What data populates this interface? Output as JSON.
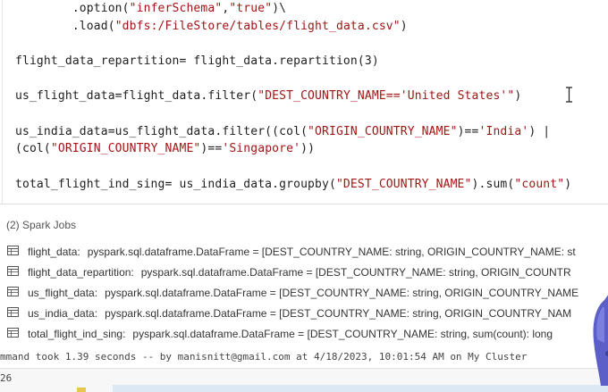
{
  "code": {
    "lines": [
      [
        {
          "t": "        .option("
        },
        {
          "t": "\"inferSchema\"",
          "s": true
        },
        {
          "t": ","
        },
        {
          "t": "\"true\"",
          "s": true
        },
        {
          "t": ")\\"
        }
      ],
      [
        {
          "t": "        .load("
        },
        {
          "t": "\"dbfs:/FileStore/tables/flight_data.csv\"",
          "s": true
        },
        {
          "t": ")"
        }
      ],
      [
        {
          "t": ""
        }
      ],
      [
        {
          "t": "flight_data_repartition= flight_data.repartition(3)"
        }
      ],
      [
        {
          "t": ""
        }
      ],
      [
        {
          "t": "us_flight_data=flight_data.filter("
        },
        {
          "t": "\"DEST_COUNTRY_NAME=='United States'\"",
          "s": true
        },
        {
          "t": ")"
        }
      ],
      [
        {
          "t": ""
        }
      ],
      [
        {
          "t": "us_india_data=us_flight_data.filter((col("
        },
        {
          "t": "\"ORIGIN_COUNTRY_NAME\"",
          "s": true
        },
        {
          "t": ")=="
        },
        {
          "t": "'India'",
          "s": true
        },
        {
          "t": ") |"
        }
      ],
      [
        {
          "t": "(col("
        },
        {
          "t": "\"ORIGIN_COUNTRY_NAME\"",
          "s": true
        },
        {
          "t": ")=="
        },
        {
          "t": "'Singapore'",
          "s": true
        },
        {
          "t": "))"
        }
      ],
      [
        {
          "t": ""
        }
      ],
      [
        {
          "t": "total_flight_ind_sing= us_india_data.groupby("
        },
        {
          "t": "\"DEST_COUNTRY_NAME\"",
          "s": true
        },
        {
          "t": ").sum("
        },
        {
          "t": "\"count\"",
          "s": true
        },
        {
          "t": ")"
        }
      ]
    ]
  },
  "output": {
    "spark_jobs_label": "(2) Spark Jobs",
    "dataframes": [
      {
        "name": "flight_data:",
        "type": "pyspark.sql.dataframe.DataFrame",
        "schema": " = [DEST_COUNTRY_NAME: string, ORIGIN_COUNTRY_NAME: st"
      },
      {
        "name": "flight_data_repartition:",
        "type": "pyspark.sql.dataframe.DataFrame",
        "schema": " = [DEST_COUNTRY_NAME: string, ORIGIN_COUNTR"
      },
      {
        "name": "us_flight_data:",
        "type": "pyspark.sql.dataframe.DataFrame",
        "schema": " = [DEST_COUNTRY_NAME: string, ORIGIN_COUNTRY_NAME"
      },
      {
        "name": "us_india_data:",
        "type": "pyspark.sql.dataframe.DataFrame",
        "schema": " = [DEST_COUNTRY_NAME: string, ORIGIN_COUNTRY_NAM"
      },
      {
        "name": "total_flight_ind_sing:",
        "type": "pyspark.sql.dataframe.DataFrame",
        "schema": " = [DEST_COUNTRY_NAME: string, sum(count): long"
      }
    ],
    "status_line": "mmand took 1.39 seconds -- by manisnitt@gmail.com at 4/18/2023, 10:01:54 AM on My Cluster"
  },
  "footer": {
    "cell_number": "26"
  },
  "colors": {
    "string_literal": "#a31515",
    "code_text": "#1f1f1f",
    "muted_text": "#555555"
  },
  "icons": {
    "table": "table-icon",
    "cursor": "text-cursor-icon"
  }
}
